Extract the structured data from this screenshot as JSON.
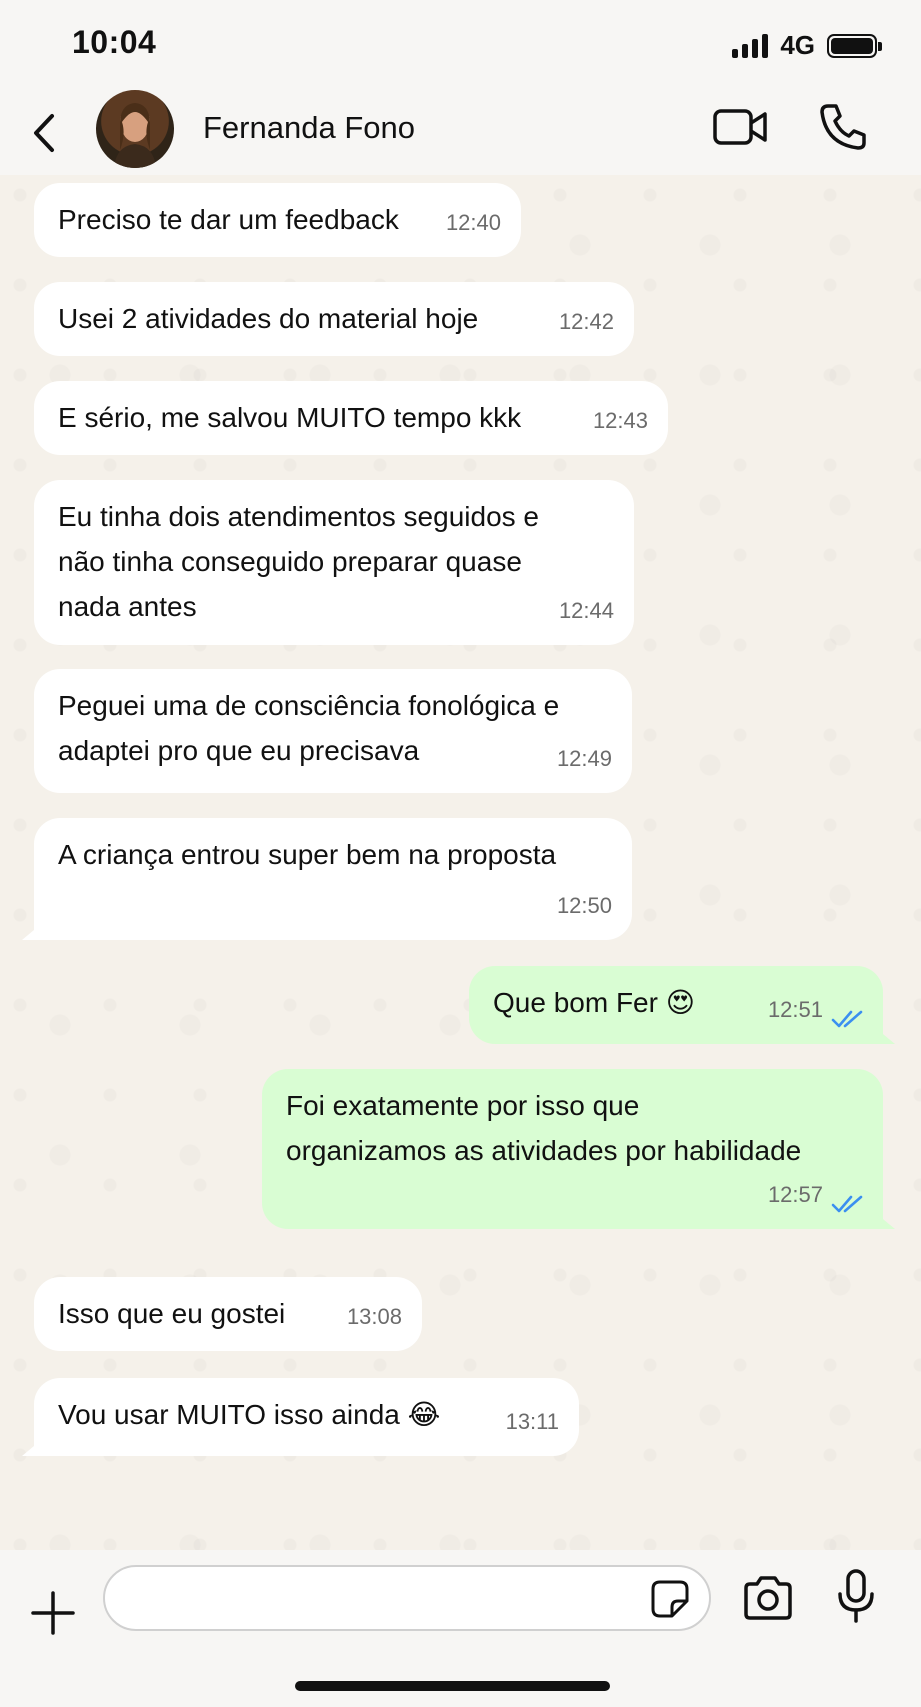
{
  "status_bar": {
    "time": "10:04",
    "network": "4G"
  },
  "header": {
    "contact_name": "Fernanda Fono"
  },
  "messages": [
    {
      "dir": "in",
      "text": "Preciso te dar um feedback",
      "time": "12:40"
    },
    {
      "dir": "in",
      "text": "Usei 2 atividades do material hoje",
      "time": "12:42"
    },
    {
      "dir": "in",
      "text": "E sério, me salvou MUITO tempo kkk",
      "time": "12:43"
    },
    {
      "dir": "in",
      "text": "Eu tinha dois atendimentos seguidos e\nnão tinha conseguido preparar quase\nnada antes",
      "time": "12:44"
    },
    {
      "dir": "in",
      "text": "Peguei uma de consciência fonológica e\nadaptei pro que eu precisava",
      "time": "12:49"
    },
    {
      "dir": "in",
      "text": "A criança entrou super bem na proposta",
      "time": "12:50"
    },
    {
      "dir": "out",
      "text": "Que bom Fer 😍",
      "time": "12:51",
      "status": "read"
    },
    {
      "dir": "out",
      "text": "Foi exatamente por isso que\norganizamos as atividades por habilidade",
      "time": "12:57",
      "status": "read"
    },
    {
      "dir": "in",
      "text": "Isso que eu gostei",
      "time": "13:08"
    },
    {
      "dir": "in",
      "text": "Vou usar MUITO isso ainda 😂",
      "time": "13:11"
    }
  ],
  "input": {
    "placeholder": ""
  },
  "colors": {
    "incoming": "#ffffff",
    "outgoing": "#d9fdd3",
    "read_ticks": "#3b8ff0",
    "background": "#f5f1ea"
  }
}
